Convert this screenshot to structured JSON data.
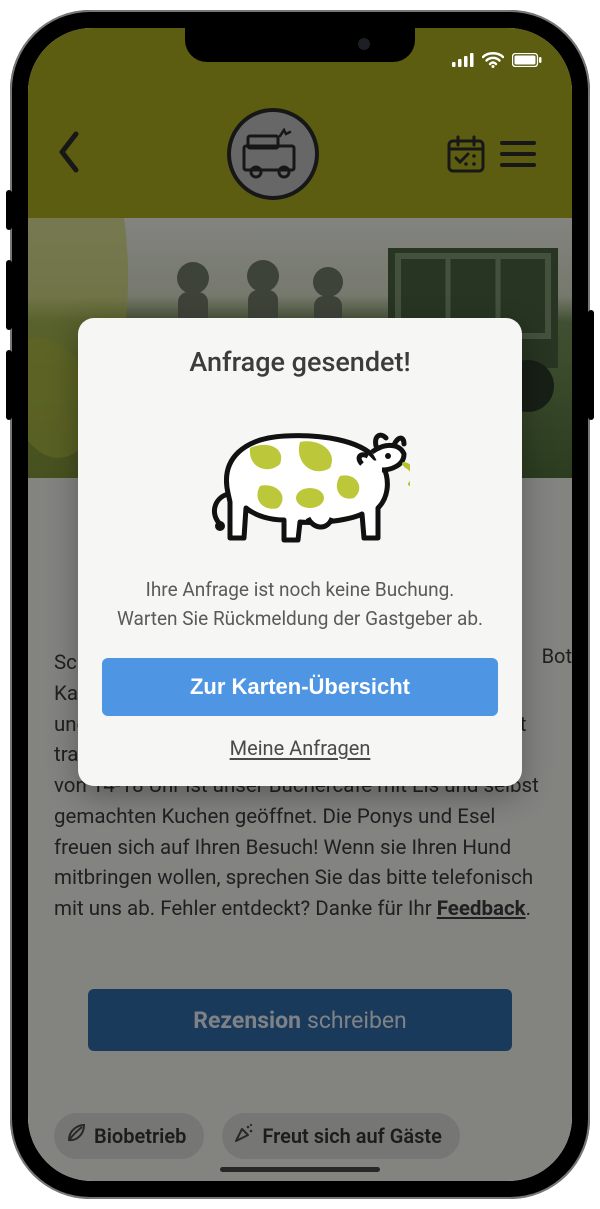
{
  "status": {
    "signal": "signal-4",
    "wifi": "wifi-3",
    "battery": "battery-full"
  },
  "header": {
    "back": "back",
    "calendar": "calendar",
    "menu": "menu"
  },
  "modal": {
    "title": "Anfrage gesendet!",
    "body_line1": "Ihre Anfrage ist noch keine Buchung.",
    "body_line2": "Warten Sie Rückmeldung der Gastgeber ab.",
    "primary": "Zur Karten-Übersicht",
    "secondary": "Meine Anfragen"
  },
  "truncated_right": "Bot",
  "description_leadin": "Schule am Dorfrand von Wolfsdorf, noch hinter der Kapelle. Der Familienbetrieb produziert Honig, Obst und Saft von den eigenen Streuobstwiesen und baut traditionelle Gemüsesorten an. Freitag bis Sonntag von 14-18 Uhr ist unser Büchercafé mit Eis und selbst gemachten Kuchen geöffnet. Die Ponys und Esel freuen sich auf Ihren Besuch! Wenn sie Ihren Hund mitbringen wollen, sprechen Sie das bitte telefonisch mit uns ab. Fehler entdeckt? Danke für Ihr ",
  "description_feedback": "Feedback",
  "description_period": ".",
  "review_button": {
    "bold": "Rezension",
    "light": "schreiben"
  },
  "tags": {
    "bio": "Biobetrieb",
    "guests": "Freut sich auf Gäste"
  },
  "colors": {
    "olive": "#a8aa1f",
    "oliveDark": "#2b2b2b",
    "blue_primary": "#4e96e3",
    "blue_dark": "#2f6aa5",
    "chip": "#d8d8d4"
  }
}
